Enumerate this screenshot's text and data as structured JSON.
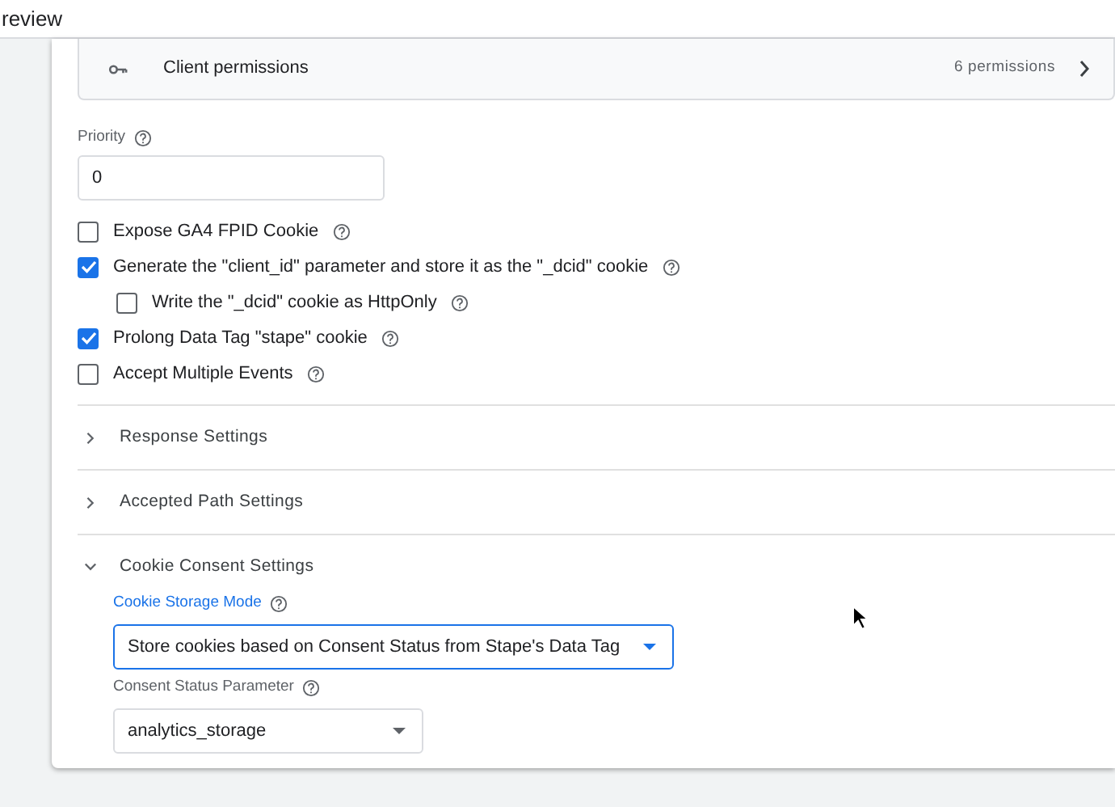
{
  "header": {
    "title": "review"
  },
  "permissions": {
    "label": "Client permissions",
    "count": "6 permissions"
  },
  "priority": {
    "label": "Priority",
    "value": "0"
  },
  "checkboxes": [
    {
      "label": "Expose GA4 FPID Cookie",
      "checked": false
    },
    {
      "label": "Generate the \"client_id\" parameter and store it as the \"_dcid\" cookie",
      "checked": true,
      "children": [
        {
          "label": "Write the \"_dcid\" cookie as HttpOnly",
          "checked": false
        }
      ]
    },
    {
      "label": "Prolong Data Tag \"stape\" cookie",
      "checked": true
    },
    {
      "label": "Accept Multiple Events",
      "checked": false
    }
  ],
  "sections": [
    {
      "title": "Response Settings",
      "expanded": false
    },
    {
      "title": "Accepted Path Settings",
      "expanded": false
    },
    {
      "title": "Cookie Consent Settings",
      "expanded": true,
      "fields": [
        {
          "label": "Cookie Storage Mode",
          "value": "Store cookies based on Consent Status from Stape's Data Tag",
          "focused": true
        },
        {
          "label": "Consent Status Parameter",
          "value": "analytics_storage",
          "focused": false
        }
      ]
    }
  ]
}
